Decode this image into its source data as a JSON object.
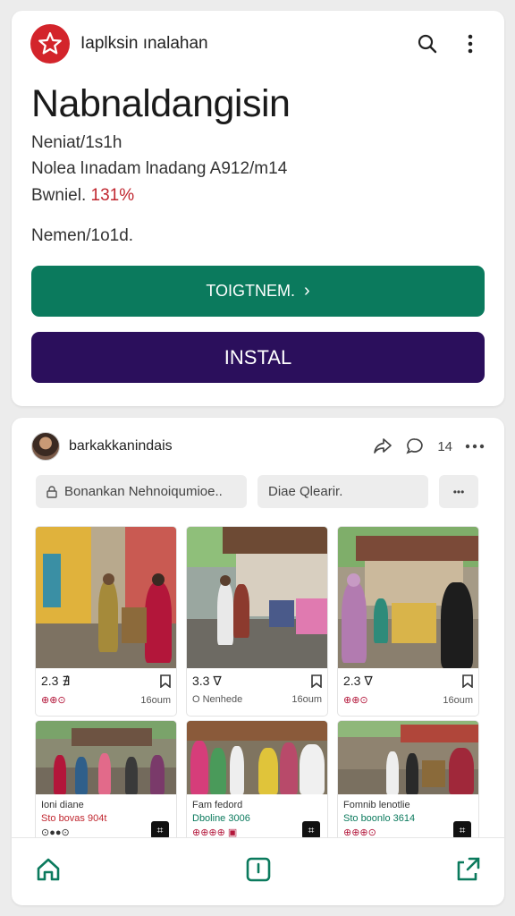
{
  "app": {
    "name": "Iaplksin ınalahan",
    "title": "Nabnaldangisin",
    "line1": "Neniat/1s1h",
    "line2": "Nolea lınadam lnadang A912/m14",
    "line3_prefix": "Bwniel.",
    "line3_highlight": "131%",
    "line4": "Nemen/1o1d.",
    "primary_button": "TOIGTNEM.",
    "primary_button_arrow": "›",
    "install_button": "INSTAL"
  },
  "post": {
    "username": "barkakkanindais",
    "count": "14",
    "chips": [
      "Bonankan Nehnoiqumioe..",
      "Diae Qlearir.",
      "•••"
    ]
  },
  "tiles": [
    {
      "value": "2.3",
      "mark": "∄",
      "left": "⊕⊕⊙",
      "right": "16oum"
    },
    {
      "value": "3.3",
      "mark": "∇",
      "left": "O Nenhede",
      "right": "16oum"
    },
    {
      "value": "2.3",
      "mark": "∇",
      "left": "⊕⊕⊙",
      "right": "16oum"
    },
    {
      "title": "Ioni diane",
      "green": "Sto bovas 904t",
      "icons": "⊙●●⊙"
    },
    {
      "title": "Fam fedord",
      "green": "Dboline 3006",
      "icons": "⊕⊕⊕⊕ ▣"
    },
    {
      "title": "Fomnib lenotlie",
      "green": "Sto boonlo 3614",
      "icons": "⊕⊕⊕⊙"
    }
  ],
  "colors": {
    "green": "#0b7a5d",
    "purple": "#2b0f5c",
    "logo_red": "#d3242b",
    "highlight_red": "#c0262f"
  },
  "icons": [
    "star-icon",
    "search-icon",
    "more-vert-icon",
    "share-icon",
    "comment-icon",
    "more-horiz-icon",
    "bookmark-icon",
    "home-icon",
    "center-nav-icon",
    "share-nav-icon"
  ]
}
